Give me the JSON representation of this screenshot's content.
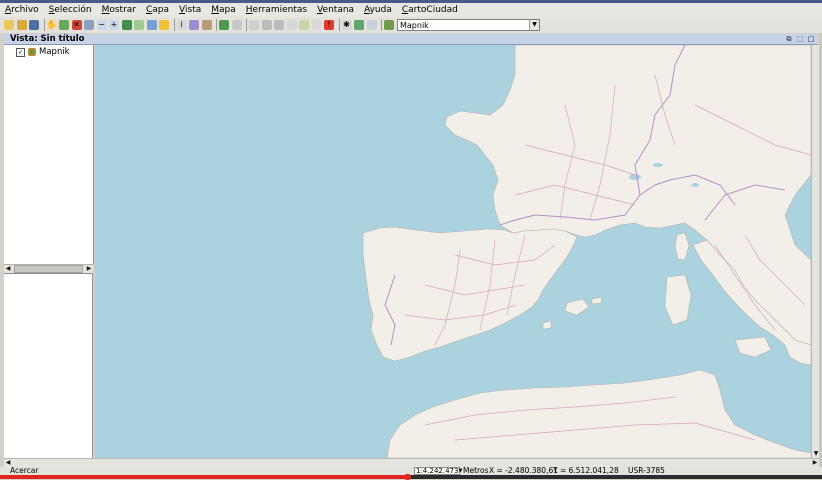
{
  "menubar": {
    "items": [
      {
        "label": "Archivo",
        "name": "menu-archivo"
      },
      {
        "label": "Selección",
        "name": "menu-seleccion"
      },
      {
        "label": "Mostrar",
        "name": "menu-mostrar"
      },
      {
        "label": "Capa",
        "name": "menu-capa"
      },
      {
        "label": "Vista",
        "name": "menu-vista"
      },
      {
        "label": "Mapa",
        "name": "menu-mapa"
      },
      {
        "label": "Herramientas",
        "name": "menu-herramientas"
      },
      {
        "label": "Ventana",
        "name": "menu-ventana"
      },
      {
        "label": "Ayuda",
        "name": "menu-ayuda"
      },
      {
        "label": "CartoCiudad",
        "name": "menu-cartociudad"
      }
    ]
  },
  "toolbar": {
    "icons": [
      {
        "name": "new-document-icon",
        "color": "#e8c95a",
        "glyph": ""
      },
      {
        "name": "open-folder-icon",
        "color": "#d9a93b",
        "glyph": ""
      },
      {
        "name": "save-icon",
        "color": "#4e6ea8",
        "glyph": ""
      },
      {
        "name": "sep"
      },
      {
        "name": "pan-hand-icon",
        "color": "#f2d7b8",
        "glyph": "✋"
      },
      {
        "name": "zoom-full-icon",
        "color": "#69a85a",
        "glyph": ""
      },
      {
        "name": "zoom-cancel-icon",
        "color": "#d0473a",
        "glyph": "✕"
      },
      {
        "name": "zoom-to-layer-icon",
        "color": "#8ea0c0",
        "glyph": ""
      },
      {
        "name": "zoom-out-icon",
        "color": "#c9d9ec",
        "glyph": "−"
      },
      {
        "name": "zoom-in-icon",
        "color": "#c9d9ec",
        "glyph": "+"
      },
      {
        "name": "layers-icon",
        "color": "#3f8e4a",
        "glyph": ""
      },
      {
        "name": "previous-view-icon",
        "color": "#9ccc8f",
        "glyph": ""
      },
      {
        "name": "locator-icon",
        "color": "#76a0d4",
        "glyph": ""
      },
      {
        "name": "measure-area-icon",
        "color": "#f0c23c",
        "glyph": ""
      },
      {
        "name": "sep"
      },
      {
        "name": "info-icon",
        "color": "#d8d8d8",
        "glyph": "i"
      },
      {
        "name": "query-icon",
        "color": "#9b8ed0",
        "glyph": ""
      },
      {
        "name": "print-icon",
        "color": "#b79a76",
        "glyph": ""
      },
      {
        "name": "sep"
      },
      {
        "name": "hyperlink-icon",
        "color": "#4a9a4a",
        "glyph": ""
      },
      {
        "name": "select-icon",
        "color": "#c8c8c8",
        "glyph": ""
      },
      {
        "name": "sep"
      },
      {
        "name": "select-point-icon",
        "color": "#d0d0d0",
        "glyph": ""
      },
      {
        "name": "select-polygon-icon",
        "color": "#bcbcbc",
        "glyph": ""
      },
      {
        "name": "select-circle-icon",
        "color": "#bcbcbc",
        "glyph": ""
      },
      {
        "name": "select-buffer-icon",
        "color": "#d6d6d6",
        "glyph": ""
      },
      {
        "name": "select-by-layer-icon",
        "color": "#c5d9a8",
        "glyph": ""
      },
      {
        "name": "invert-selection-icon",
        "color": "#d9d9d9",
        "glyph": ""
      },
      {
        "name": "stop-icon",
        "color": "#e03a2a",
        "glyph": "!"
      },
      {
        "name": "sep"
      },
      {
        "name": "tools-icon",
        "color": "#d7d7d7",
        "glyph": "✱"
      },
      {
        "name": "georeference-icon",
        "color": "#5fa56c",
        "glyph": ""
      },
      {
        "name": "table-icon",
        "color": "#c8d0dc",
        "glyph": ""
      },
      {
        "name": "sep"
      },
      {
        "name": "edit-layer-icon",
        "color": "#6f9b4a",
        "glyph": ""
      },
      {
        "name": "layer-combo-icon",
        "color": "#a9b5c6",
        "glyph": ""
      }
    ],
    "layer_select_value": "Mapnik",
    "layer_select_arrow": "▼"
  },
  "view": {
    "title": "Vista: Sin título",
    "controls": [
      "⧉",
      "⬚",
      "□"
    ]
  },
  "toc": {
    "layers": [
      {
        "label": "Mapnik",
        "checked": "✓"
      }
    ]
  },
  "scrollbars": {
    "left_arrow": "◀",
    "right_arrow": "▶",
    "up_arrow": "▲",
    "down_arrow": "▼"
  },
  "statusbar": {
    "message": "Acercar",
    "scale": "1:4.242.473",
    "scale_arrow": "▼",
    "units": "Metros",
    "x": "X = -2.480.380,61",
    "y": "Y = 6.512.041,28",
    "crs": "USR-3785"
  },
  "map": {
    "sea_color": "#aad3df",
    "land_color": "#f2efe9",
    "road_color": "#d79bb2",
    "border_color": "#b48fc6",
    "lake_color": "#aad3df"
  }
}
